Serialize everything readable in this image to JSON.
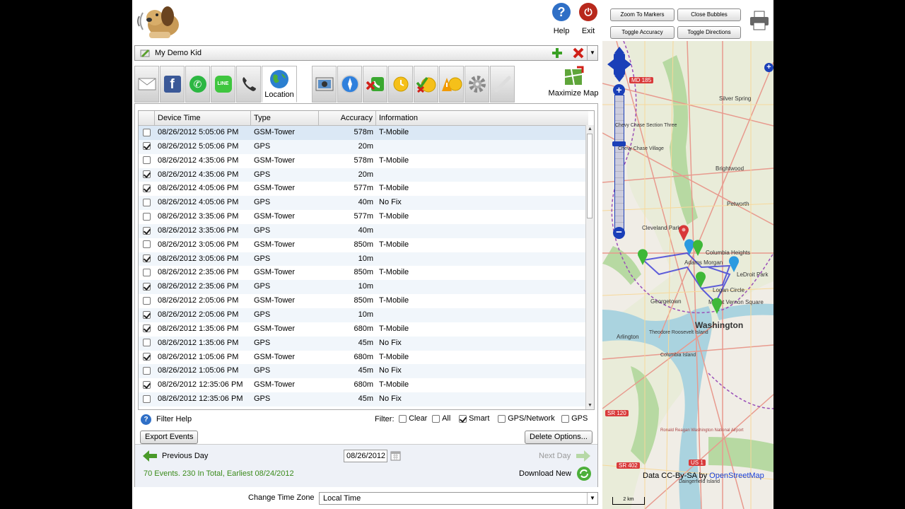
{
  "header": {
    "help_label": "Help",
    "exit_label": "Exit",
    "help_color": "#2f6fc6",
    "exit_color": "#b8281c"
  },
  "device": {
    "name": "My Demo Kid"
  },
  "tabs": {
    "active_label": "Location",
    "maximize_label": "Maximize Map",
    "icons": [
      "email-icon",
      "facebook-icon",
      "whatsapp-icon",
      "line-icon",
      "phone-icon",
      "location-icon",
      "photos-icon",
      "safari-icon",
      "blocked-call-icon",
      "alert-icon",
      "approve-icon",
      "warning-icon",
      "settings-icon",
      "disabled-link-icon"
    ]
  },
  "grid": {
    "columns": [
      "Device Time",
      "Type",
      "Accuracy",
      "Information"
    ],
    "rows": [
      {
        "checked": false,
        "time": "08/26/2012 5:05:06 PM",
        "type": "GSM-Tower",
        "accuracy": "578m",
        "info": "T-Mobile"
      },
      {
        "checked": true,
        "time": "08/26/2012 5:05:06 PM",
        "type": "GPS",
        "accuracy": "20m",
        "info": ""
      },
      {
        "checked": false,
        "time": "08/26/2012 4:35:06 PM",
        "type": "GSM-Tower",
        "accuracy": "578m",
        "info": "T-Mobile"
      },
      {
        "checked": true,
        "time": "08/26/2012 4:35:06 PM",
        "type": "GPS",
        "accuracy": "20m",
        "info": ""
      },
      {
        "checked": true,
        "time": "08/26/2012 4:05:06 PM",
        "type": "GSM-Tower",
        "accuracy": "577m",
        "info": "T-Mobile"
      },
      {
        "checked": false,
        "time": "08/26/2012 4:05:06 PM",
        "type": "GPS",
        "accuracy": "40m",
        "info": "No Fix"
      },
      {
        "checked": false,
        "time": "08/26/2012 3:35:06 PM",
        "type": "GSM-Tower",
        "accuracy": "577m",
        "info": "T-Mobile"
      },
      {
        "checked": true,
        "time": "08/26/2012 3:35:06 PM",
        "type": "GPS",
        "accuracy": "40m",
        "info": ""
      },
      {
        "checked": false,
        "time": "08/26/2012 3:05:06 PM",
        "type": "GSM-Tower",
        "accuracy": "850m",
        "info": "T-Mobile"
      },
      {
        "checked": true,
        "time": "08/26/2012 3:05:06 PM",
        "type": "GPS",
        "accuracy": "10m",
        "info": ""
      },
      {
        "checked": false,
        "time": "08/26/2012 2:35:06 PM",
        "type": "GSM-Tower",
        "accuracy": "850m",
        "info": "T-Mobile"
      },
      {
        "checked": true,
        "time": "08/26/2012 2:35:06 PM",
        "type": "GPS",
        "accuracy": "10m",
        "info": ""
      },
      {
        "checked": false,
        "time": "08/26/2012 2:05:06 PM",
        "type": "GSM-Tower",
        "accuracy": "850m",
        "info": "T-Mobile"
      },
      {
        "checked": true,
        "time": "08/26/2012 2:05:06 PM",
        "type": "GPS",
        "accuracy": "10m",
        "info": ""
      },
      {
        "checked": true,
        "time": "08/26/2012 1:35:06 PM",
        "type": "GSM-Tower",
        "accuracy": "680m",
        "info": "T-Mobile"
      },
      {
        "checked": false,
        "time": "08/26/2012 1:35:06 PM",
        "type": "GPS",
        "accuracy": "45m",
        "info": "No Fix"
      },
      {
        "checked": true,
        "time": "08/26/2012 1:05:06 PM",
        "type": "GSM-Tower",
        "accuracy": "680m",
        "info": "T-Mobile"
      },
      {
        "checked": false,
        "time": "08/26/2012 1:05:06 PM",
        "type": "GPS",
        "accuracy": "45m",
        "info": "No Fix"
      },
      {
        "checked": true,
        "time": "08/26/2012 12:35:06 PM",
        "type": "GSM-Tower",
        "accuracy": "680m",
        "info": "T-Mobile"
      },
      {
        "checked": false,
        "time": "08/26/2012 12:35:06 PM",
        "type": "GPS",
        "accuracy": "45m",
        "info": "No Fix"
      }
    ]
  },
  "filter": {
    "help_label": "Filter Help",
    "label": "Filter:",
    "options": [
      {
        "label": "Clear",
        "checked": false
      },
      {
        "label": "All",
        "checked": false
      },
      {
        "label": "Smart",
        "checked": true
      },
      {
        "label": "GPS/Network",
        "checked": false
      },
      {
        "label": "GPS",
        "checked": false
      }
    ]
  },
  "actions": {
    "export_label": "Export Events",
    "delete_label": "Delete Options..."
  },
  "footer": {
    "prev_label": "Previous Day",
    "next_label": "Next Day",
    "date_value": "08/26/2012",
    "summary": "70 Events. 230 In Total, Earliest 08/24/2012",
    "download_label": "Download New"
  },
  "timezone": {
    "label": "Change Time Zone",
    "value": "Local Time"
  },
  "map": {
    "buttons": {
      "zoom_markers": "Zoom To Markers",
      "close_bubbles": "Close Bubbles",
      "toggle_accuracy": "Toggle Accuracy",
      "toggle_directions": "Toggle Directions"
    },
    "road_shields": [
      "MD 185",
      "SR 120",
      "SR 402",
      "US 1"
    ],
    "places": [
      "Silver Spring",
      "Chevy Chase Section Three",
      "Chevy Chase Village",
      "Brightwood",
      "Petworth",
      "Cleveland Park",
      "Columbia Heights",
      "Adams Morgan",
      "LeDroit Park",
      "Logan Circle",
      "Georgetown",
      "Mount Vernon Square",
      "Washington",
      "Arlington",
      "Theodore Roosevelt Island",
      "Columbia Island",
      "Ronald Reagan Washington National Airport",
      "Daingerfield Island"
    ],
    "attribution": "Data CC-By-SA by ",
    "attribution_link": "OpenStreetMap",
    "scale": "2 km"
  }
}
